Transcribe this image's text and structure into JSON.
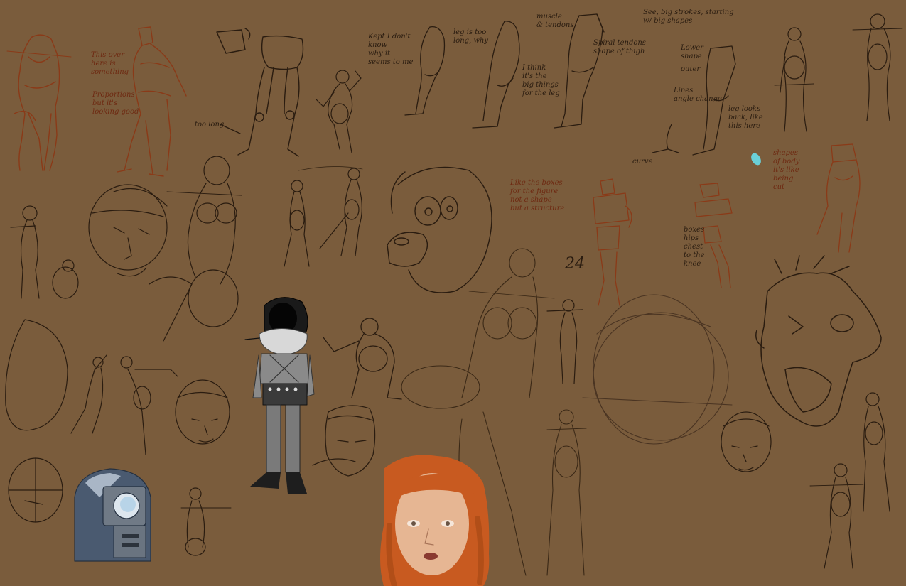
{
  "canvas": {
    "background": "#7a5c3c",
    "ink_dark": "#2a1c10",
    "ink_red": "#8a3a18",
    "hair_orange": "#c85a20",
    "skin": "#e8b894",
    "coat_grey": "#8a8a8a",
    "robot_blue": "#3a4a5e",
    "highlight_cyan": "#6ad0d8"
  },
  "notes": {
    "note_torso": "This over\nhere is\nsomething",
    "note_proportion": "Proportions\nbut it's\nlooking good",
    "note_kept": "Kept I don't\nknow\nwhy it\nseems to me",
    "note_leg": "leg is too\nlong, why",
    "note_gesture": "I think\nit's the\nbig things\nfor the leg",
    "note_muscle": "muscle\n& tendons",
    "note_spiral": "Spiral tendons\nshape of thigh",
    "note_strokes": "See, big strokes, starting\nw/ big shapes",
    "note_leg_back": "leg looks\nback, like\nthis here",
    "note_lines": "Lines\nangle change",
    "note_lower": "Lower\nshape",
    "note_outer": "outer",
    "note_shapes": "shapes\nof body\nit's like\nbeing\ncut",
    "note_boxes": "Like the boxes\nfor the figure\nnot a shape\nbut a structure",
    "note_box_figure": "boxes\nhips\nchest\nto the\nknee",
    "note_num": "24",
    "note_arrow": "too long",
    "note_curve": "curve"
  },
  "figures": [
    {
      "name": "figure-torso-red-left"
    },
    {
      "name": "figure-torso-red-right"
    },
    {
      "name": "figure-legs-front"
    },
    {
      "name": "figure-gesture-small"
    },
    {
      "name": "figure-leg-study-1"
    },
    {
      "name": "figure-leg-study-2"
    },
    {
      "name": "figure-leg-study-3"
    },
    {
      "name": "figure-standing-right"
    },
    {
      "name": "figure-standing-top-right"
    },
    {
      "name": "figure-red-pose-right"
    },
    {
      "name": "figure-box-model"
    },
    {
      "name": "figure-red-back"
    }
  ]
}
